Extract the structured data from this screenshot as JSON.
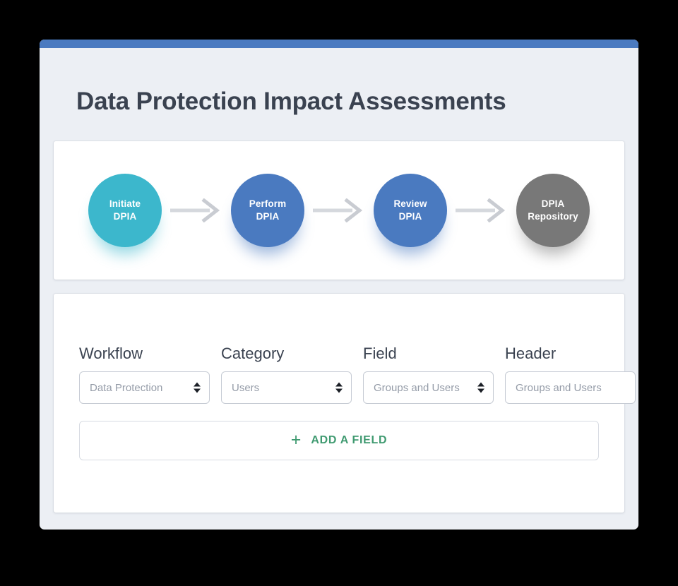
{
  "window": {
    "title_bar_color": "#4a7ac0",
    "background_color": "#eceff4"
  },
  "header": {
    "title": "Data Protection Impact Assessments"
  },
  "workflow": {
    "nodes": [
      {
        "label": "Initiate\nDPIA",
        "color": "#3cb7cc",
        "glow": "#3cb7cc"
      },
      {
        "label": "Perform\nDPIA",
        "color": "#4a7ac0",
        "glow": "#4a7ac0"
      },
      {
        "label": "Review\nDPIA",
        "color": "#4a7ac0",
        "glow": "#4a7ac0"
      },
      {
        "label": "DPIA\nRepository",
        "color": "#787878",
        "glow": "#787878"
      }
    ],
    "arrow_icon": "arrow-right-icon",
    "arrow_color": "#d5d8dd"
  },
  "form": {
    "fields": [
      {
        "label": "Workflow",
        "value": "Data Protection",
        "type": "select",
        "name": "workflow"
      },
      {
        "label": "Category",
        "value": "Users",
        "type": "select",
        "name": "category"
      },
      {
        "label": "Field",
        "value": "Groups and Users",
        "type": "select",
        "name": "field"
      },
      {
        "label": "Header",
        "value": "Groups and Users",
        "type": "text",
        "name": "header"
      }
    ],
    "add_button": {
      "label": "ADD A FIELD",
      "icon": "plus-icon",
      "color": "#3f9a70"
    }
  }
}
